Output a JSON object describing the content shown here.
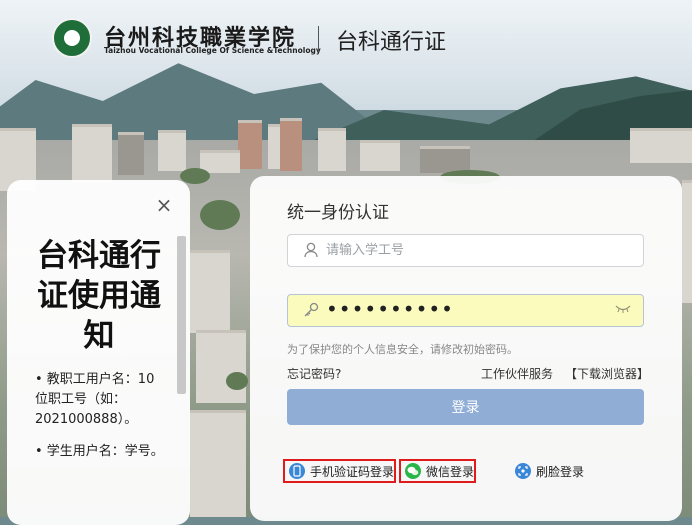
{
  "header": {
    "school_name_cn": "台州科技職業学院",
    "school_name_en": "Taizhou Vocational College Of Science &Technology",
    "app_title": "台科通行证"
  },
  "notice": {
    "close_icon": "×",
    "title": "台科通行证使用通知",
    "paragraphs": [
      "• 教职工用户名：10位职工号（如：2021000888）。",
      "• 学生用户名：学号。"
    ]
  },
  "login": {
    "title": "统一身份认证",
    "username_placeholder": "请输入学工号",
    "password_value": "••••••••••",
    "user_icon": "user-icon",
    "key_icon": "key-icon",
    "hint": "为了保护您的个人信息安全，请修改初始密码。",
    "forgot_password": "忘记密码?",
    "partner_service": "工作伙伴服务",
    "download_browser": "【下载浏览器】",
    "login_button": "登录",
    "alt_logins": {
      "phone_label": "手机验证码登录",
      "wechat_label": "微信登录",
      "face_label": "刷脸登录"
    }
  },
  "colors": {
    "login_button": "#8fadd5",
    "highlight_box": "#e01b1b",
    "wechat": "#2ab54a",
    "accent_blue": "#3a87d8"
  }
}
